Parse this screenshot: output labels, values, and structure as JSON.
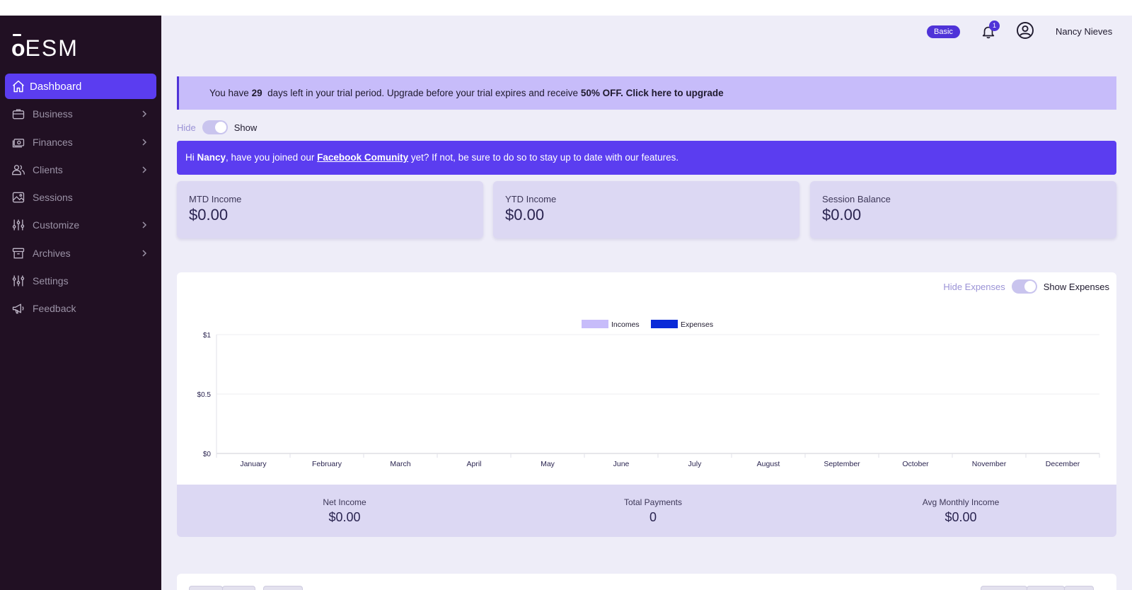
{
  "brand": {
    "logo_o": "o",
    "logo_rest": "ESM"
  },
  "sidebar": {
    "items": [
      {
        "label": "Dashboard",
        "icon": "home-icon",
        "active": true,
        "chevron": false
      },
      {
        "label": "Business",
        "icon": "briefcase-icon",
        "chevron": true
      },
      {
        "label": "Finances",
        "icon": "cash-icon",
        "chevron": true
      },
      {
        "label": "Clients",
        "icon": "users-icon",
        "chevron": true
      },
      {
        "label": "Sessions",
        "icon": "image-icon",
        "chevron": false
      },
      {
        "label": "Customize",
        "icon": "sliders-icon",
        "chevron": true
      },
      {
        "label": "Archives",
        "icon": "archive-icon",
        "chevron": true
      },
      {
        "label": "Settings",
        "icon": "settings-sliders-icon",
        "chevron": false
      },
      {
        "label": "Feedback",
        "icon": "megaphone-icon",
        "chevron": false
      }
    ]
  },
  "header": {
    "plan_badge": "Basic",
    "notification_count": "1",
    "user_name": "Nancy Nieves"
  },
  "trial_banner": {
    "prefix": "You have ",
    "days": "29",
    "middle": "  days left in your trial period. Upgrade before your trial expires and receive ",
    "cta": "50% OFF. Click here to upgrade"
  },
  "visibility_toggle": {
    "off_label": "Hide",
    "on_label": "Show"
  },
  "community_banner": {
    "greeting": "Hi ",
    "name": "Nancy",
    "text1": ", have you joined our ",
    "link": "Facebook Comunity",
    "text2": " yet? If not, be sure to do so to stay up to date with our features."
  },
  "stats": [
    {
      "title": "MTD Income",
      "value": "$0.00"
    },
    {
      "title": "YTD Income",
      "value": "$0.00"
    },
    {
      "title": "Session Balance",
      "value": "$0.00"
    }
  ],
  "expenses_toggle": {
    "off_label": "Hide Expenses",
    "on_label": "Show Expenses"
  },
  "summary": [
    {
      "title": "Net Income",
      "value": "$0.00"
    },
    {
      "title": "Total Payments",
      "value": "0"
    },
    {
      "title": "Avg Monthly Income",
      "value": "$0.00"
    }
  ],
  "colors": {
    "incomes": "#c7bcfa",
    "expenses": "#0a2ad8",
    "accent": "#5b3df0",
    "sidebar": "#211023"
  },
  "chart_data": {
    "type": "bar",
    "categories": [
      "January",
      "February",
      "March",
      "April",
      "May",
      "June",
      "July",
      "August",
      "September",
      "October",
      "November",
      "December"
    ],
    "series": [
      {
        "name": "Incomes",
        "values": [
          0,
          0,
          0,
          0,
          0,
          0,
          0,
          0,
          0,
          0,
          0,
          0
        ]
      },
      {
        "name": "Expenses",
        "values": [
          0,
          0,
          0,
          0,
          0,
          0,
          0,
          0,
          0,
          0,
          0,
          0
        ]
      }
    ],
    "yticks": [
      "$0",
      "$0.5",
      "$1"
    ],
    "ylim": [
      0,
      1
    ],
    "legend": "top-center",
    "grid": true
  }
}
